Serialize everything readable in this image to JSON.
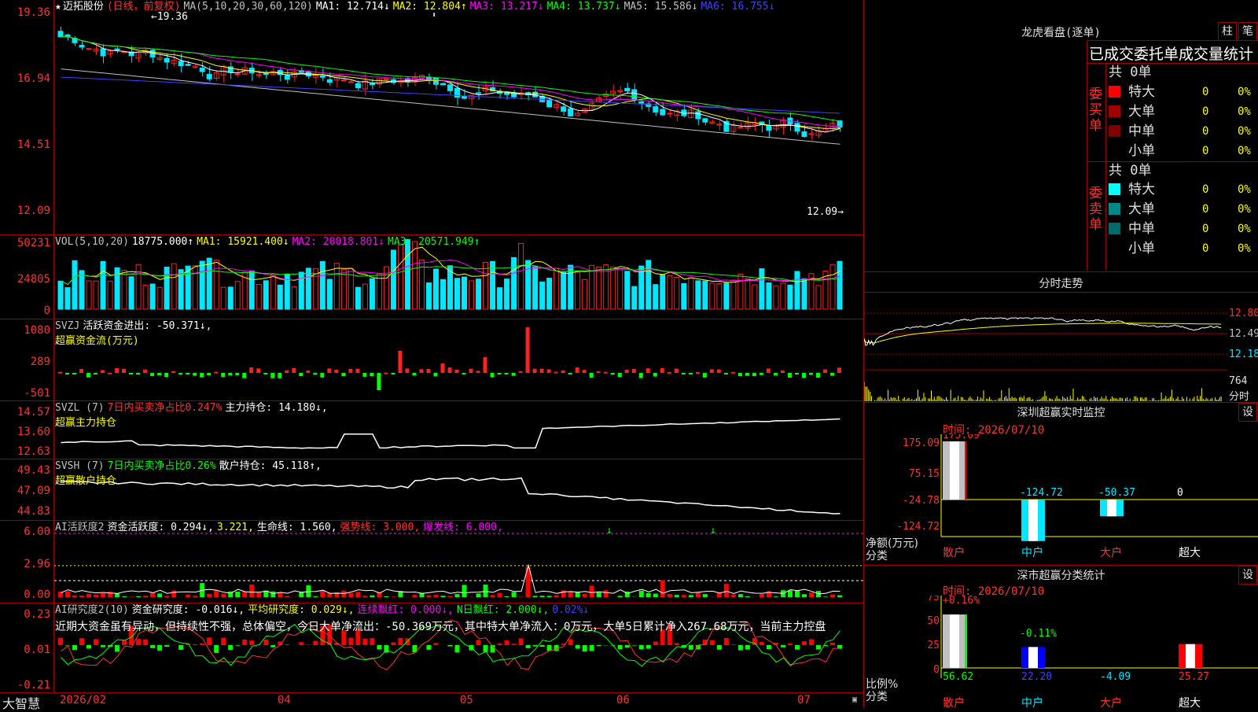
{
  "colors": {
    "up": "#ff2020",
    "down": "#00e8ff",
    "grid": "#a00000",
    "axis": "#ff3030",
    "ma1": "#ffffff",
    "ma2": "#ffff00",
    "ma3": "#ff00ff",
    "ma4": "#00ff00",
    "ma5": "#c0c0c0",
    "ma6": "#4040ff"
  },
  "main": {
    "title": "迈拓股份",
    "period": "(日线，前复权)",
    "ma_params": "MA(5,10,20,30,60,120)",
    "ma": [
      {
        "label": "MA1: 12.714↓",
        "color": "#ffffff"
      },
      {
        "label": "MA2: 12.804↑",
        "color": "#ffff00"
      },
      {
        "label": "MA3: 13.217↓",
        "color": "#ff00ff"
      },
      {
        "label": "MA4: 13.737↓",
        "color": "#00ff00"
      },
      {
        "label": "MA5: 15.586↓",
        "color": "#c0c0c0"
      },
      {
        "label": "MA6: 16.755↓",
        "color": "#4040ff"
      }
    ],
    "y_labels": [
      "19.36",
      "16.94",
      "14.51",
      "12.09"
    ],
    "high_mark": "19.36",
    "low_mark": "12.09"
  },
  "vol": {
    "params": "VOL(5,10,20)",
    "value": "18775.000↑",
    "ma": [
      {
        "label": "MA1: 15921.400↓",
        "color": "#ffff00"
      },
      {
        "label": "MA2: 20018.801↓",
        "color": "#ff00ff"
      },
      {
        "label": "MA3: 20571.949↑",
        "color": "#00ff00"
      }
    ],
    "y_labels": [
      "50231",
      "24805",
      "0"
    ]
  },
  "svzj": {
    "title": "SVZJ",
    "label": "活跃资金进出: -50.371↓,",
    "sub": "超赢资金流(万元)",
    "y_labels": [
      "1080",
      "289",
      "-501"
    ]
  },
  "svzl": {
    "title": "SVZL (7)",
    "p1": "7日内买卖净占比0.247%",
    "p2": "主力持仓: 14.180↓,",
    "sub": "超赢主力持仓",
    "y_labels": [
      "14.57",
      "13.60",
      "12.63"
    ]
  },
  "svsh": {
    "title": "SVSH (7)",
    "p1": "7日内买卖净占比0.26%",
    "p2": "散户持仓: 45.118↑,",
    "sub": "超赢散户持仓",
    "y_labels": [
      "49.43",
      "47.09",
      "44.83"
    ]
  },
  "ai1": {
    "title": "AI活跃度2",
    "p1": "资金活跃度: 0.294↓,",
    "p2": "3.221,",
    "p3": "生命线: 1.560,",
    "p4": "强势线: 3.000,",
    "p5": "爆发线: 6.000,",
    "y_labels": [
      "6.00",
      "2.96",
      "0.00"
    ]
  },
  "ai2": {
    "title": "AI研究度2(10)",
    "p1": "资金研究度: -0.016↓,",
    "p2": "平均研究度: 0.029↓,",
    "p3": "连续飘红: 0.000↓,",
    "p4": "N日飘红: 2.000↓,",
    "p5": "0.02%↓",
    "comment": "近期大资金虽有异动，但持续性不强，总体偏空，今日大单净流出：-50.369万元，其中特大单净流入：0万元，大单5日累计净入267.68万元，当前主力控盘",
    "y_labels": [
      "0.23",
      "0.01",
      "-0.21"
    ]
  },
  "xaxis": {
    "labels": [
      "2026/02",
      "04",
      "05",
      "06",
      "07"
    ],
    "brand": "大智慧"
  },
  "lhb": {
    "title": "龙虎看盘(逐单)",
    "btn1": "柱",
    "btn2": "笔",
    "stat_title": "已成交委托单成交量统计",
    "buy_label": "委买单",
    "sell_label": "委卖单",
    "buy_total": "共 0单",
    "sell_total": "共 0单",
    "buy_rows": [
      {
        "name": "特大",
        "v": "0",
        "p": "0%",
        "c": "#ff0000"
      },
      {
        "name": "大单",
        "v": "0",
        "p": "0%",
        "c": "#a00000"
      },
      {
        "name": "中单",
        "v": "0",
        "p": "0%",
        "c": "#800000"
      },
      {
        "name": "小单",
        "v": "0",
        "p": "0%",
        "c": "#000000"
      }
    ],
    "sell_rows": [
      {
        "name": "特大",
        "v": "0",
        "p": "0%",
        "c": "#00ffff"
      },
      {
        "name": "大单",
        "v": "0",
        "p": "0%",
        "c": "#008888"
      },
      {
        "name": "中单",
        "v": "0",
        "p": "0%",
        "c": "#006a6a"
      },
      {
        "name": "小单",
        "v": "0",
        "p": "0%",
        "c": "#000000"
      }
    ]
  },
  "intraday": {
    "title": "分时走势",
    "y_labels": [
      "12.80",
      "12.49",
      "12.18"
    ],
    "vol_label": "764",
    "vol_unit": "分时"
  },
  "monitor": {
    "title": "深圳超赢实时监控",
    "btn": "设",
    "time": "时间: 2026/07/10",
    "y_labels": [
      "175.09",
      "75.15",
      "-24.78",
      "-124.72"
    ],
    "unit1": "净额(万元)",
    "unit2": "分类",
    "cats": [
      "散户",
      "中户",
      "大户",
      "超大"
    ],
    "values": [
      "175.09",
      "-124.72",
      "-50.37",
      "0"
    ]
  },
  "classify": {
    "title": "深市超赢分类统计",
    "btn": "设",
    "time": "时间: 2026/07/10",
    "y_labels": [
      "75",
      "50",
      "25",
      "0"
    ],
    "unit1": "比例%",
    "unit2": "分类",
    "cats": [
      "散户",
      "中户",
      "大户",
      "超大"
    ],
    "top": [
      "+0.16%",
      "-0.11%"
    ],
    "bottom": [
      "56.62",
      "22.20",
      "-4.09",
      "25.27"
    ]
  }
}
